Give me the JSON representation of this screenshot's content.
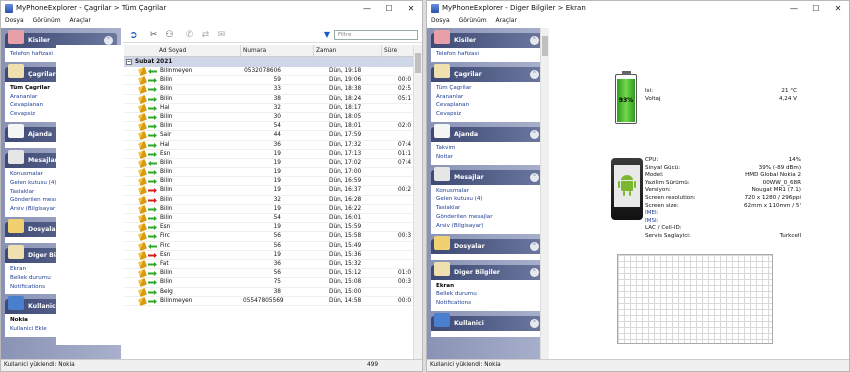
{
  "colors": {
    "sidebar_head": "#3e4a74",
    "link": "#1f3e96",
    "group_band": "#cfd6e8",
    "battery_green": "#4cc232"
  },
  "left_window": {
    "title": "MyPhoneExplorer - Çagrilar > Tüm Çagrilar",
    "controls": [
      "—",
      "☐",
      "✕"
    ],
    "menu": [
      "Dosya",
      "Görünüm",
      "Araçlar"
    ],
    "sidebar": [
      {
        "title": "Kisiler",
        "icon": "contacts-icon",
        "items": [
          {
            "label": "Telefon hafizasi",
            "selected": false
          }
        ]
      },
      {
        "title": "Çagrilar",
        "icon": "calls-icon",
        "items": [
          {
            "label": "Tüm Çagrilar",
            "selected": true
          },
          {
            "label": "Arananlar",
            "selected": false
          },
          {
            "label": "Cevaplanan",
            "selected": false
          },
          {
            "label": "Cevapsiz",
            "selected": false
          }
        ]
      },
      {
        "title": "Ajanda",
        "icon": "calendar-icon",
        "items": []
      },
      {
        "title": "Mesajlar",
        "icon": "messages-icon",
        "items": [
          {
            "label": "Konusmalar",
            "selected": false
          },
          {
            "label": "Gelen kutusu (4)",
            "selected": false
          },
          {
            "label": "Taslaklar",
            "selected": false
          },
          {
            "label": "Gönderilen mesajlar",
            "selected": false
          },
          {
            "label": "Arsiv (Bilgisayar)",
            "selected": false
          }
        ]
      },
      {
        "title": "Dosyalar",
        "icon": "folder-icon",
        "items": []
      },
      {
        "title": "Diger Bilgiler",
        "icon": "info-icon",
        "items": [
          {
            "label": "Ekran",
            "selected": false
          },
          {
            "label": "Bellek durumu",
            "selected": false
          },
          {
            "label": "Notifications",
            "selected": false
          }
        ]
      },
      {
        "title": "Kullanici",
        "icon": "user-icon",
        "items": [
          {
            "label": "Nokia",
            "selected": true
          },
          {
            "label": "Kullanici Ekle",
            "selected": false
          }
        ]
      }
    ],
    "filter_placeholder": "Filtre",
    "columns": [
      "Ad Soyad",
      "Numara",
      "Zaman",
      "Süre"
    ],
    "group": "Subat 2021",
    "rows": [
      {
        "name": "Bilinmeyen",
        "number": "0532078606",
        "time": "Dün, 19:18",
        "dur": "",
        "dir": "in"
      },
      {
        "name": "Bilin",
        "number": "59",
        "time": "Dün, 19:06",
        "dur": "00:0",
        "dir": "out"
      },
      {
        "name": "Bilin",
        "number": "33",
        "time": "Dün, 18:38",
        "dur": "02:5",
        "dir": "out"
      },
      {
        "name": "Bilin",
        "number": "38",
        "time": "Dün, 18:24",
        "dur": "05:1",
        "dir": "out"
      },
      {
        "name": "Hal",
        "number": "32",
        "time": "Dün, 18:17",
        "dur": "",
        "dir": "out"
      },
      {
        "name": "Bilin",
        "number": "30",
        "time": "Dün, 18:05",
        "dur": "",
        "dir": "out"
      },
      {
        "name": "Bilin",
        "number": "54",
        "time": "Dün, 18:01",
        "dur": "02:0",
        "dir": "out"
      },
      {
        "name": "Sair",
        "number": "44",
        "time": "Dün, 17:59",
        "dur": "",
        "dir": "out"
      },
      {
        "name": "Hal",
        "number": "36",
        "time": "Dün, 17:32",
        "dur": "07:4",
        "dir": "out"
      },
      {
        "name": "Esn",
        "number": "19",
        "time": "Dün, 17:13",
        "dur": "01:1",
        "dir": "out"
      },
      {
        "name": "Bilin",
        "number": "19",
        "time": "Dün, 17:02",
        "dur": "07:4",
        "dir": "in"
      },
      {
        "name": "Bilin",
        "number": "19",
        "time": "Dün, 17:00",
        "dur": "",
        "dir": "out"
      },
      {
        "name": "Bilin",
        "number": "19",
        "time": "Dün, 16:59",
        "dur": "",
        "dir": "out"
      },
      {
        "name": "Bilin",
        "number": "19",
        "time": "Dün, 16:37",
        "dur": "00:2",
        "dir": "missed"
      },
      {
        "name": "Bilin",
        "number": "32",
        "time": "Dün, 16:28",
        "dur": "",
        "dir": "missed"
      },
      {
        "name": "Bilin",
        "number": "19",
        "time": "Dün, 16:22",
        "dur": "",
        "dir": "out"
      },
      {
        "name": "Bilin",
        "number": "54",
        "time": "Dün, 16:01",
        "dur": "",
        "dir": "out"
      },
      {
        "name": "Esn",
        "number": "19",
        "time": "Dün, 15:59",
        "dur": "",
        "dir": "out"
      },
      {
        "name": "Firc",
        "number": "56",
        "time": "Dün, 15:58",
        "dur": "00:3",
        "dir": "out"
      },
      {
        "name": "Firc",
        "number": "56",
        "time": "Dün, 15:49",
        "dur": "",
        "dir": "in"
      },
      {
        "name": "Esn",
        "number": "19",
        "time": "Dün, 15:36",
        "dur": "",
        "dir": "missed"
      },
      {
        "name": "Fat",
        "number": "36",
        "time": "Dün, 15:32",
        "dur": "",
        "dir": "out"
      },
      {
        "name": "Bilin",
        "number": "56",
        "time": "Dün, 15:12",
        "dur": "01:0",
        "dir": "out"
      },
      {
        "name": "Bilin",
        "number": "75",
        "time": "Dün, 15:08",
        "dur": "00:3",
        "dir": "out"
      },
      {
        "name": "Belg",
        "number": "38",
        "time": "Dün, 15:00",
        "dur": "",
        "dir": "out"
      },
      {
        "name": "Bilinmeyen",
        "number": "05547805569",
        "time": "Dün, 14:58",
        "dur": "00:0",
        "dir": "out"
      }
    ],
    "status": "Kullanici yüklendi: Nokia",
    "count": "499"
  },
  "right_window": {
    "title": "MyPhoneExplorer - Diger Bilgiler > Ekran",
    "controls": [
      "—",
      "☐",
      "✕"
    ],
    "menu": [
      "Dosya",
      "Görünüm",
      "Araçlar"
    ],
    "sidebar": [
      {
        "title": "Kisiler",
        "icon": "contacts-icon",
        "items": [
          {
            "label": "Telefon hafizasi",
            "selected": false
          }
        ]
      },
      {
        "title": "Çagrilar",
        "icon": "calls-icon",
        "items": [
          {
            "label": "Tüm Çagrilar",
            "selected": false
          },
          {
            "label": "Arananlar",
            "selected": false
          },
          {
            "label": "Cevaplanan",
            "selected": false
          },
          {
            "label": "Cevapsiz",
            "selected": false
          }
        ]
      },
      {
        "title": "Ajanda",
        "icon": "calendar-icon",
        "items": [
          {
            "label": "Takvim",
            "selected": false
          },
          {
            "label": "Notlar",
            "selected": false
          }
        ]
      },
      {
        "title": "Mesajlar",
        "icon": "messages-icon",
        "items": [
          {
            "label": "Konusmalar",
            "selected": false
          },
          {
            "label": "Gelen kutusu (4)",
            "selected": false
          },
          {
            "label": "Taslaklar",
            "selected": false
          },
          {
            "label": "Gönderilen mesajlar",
            "selected": false
          },
          {
            "label": "Arsiv (Bilgisayar)",
            "selected": false
          }
        ]
      },
      {
        "title": "Dosyalar",
        "icon": "folder-icon",
        "items": []
      },
      {
        "title": "Diger Bilgiler",
        "icon": "info-icon",
        "items": [
          {
            "label": "Ekran",
            "selected": true
          },
          {
            "label": "Bellek durumu",
            "selected": false
          },
          {
            "label": "Notifications",
            "selected": false
          }
        ]
      },
      {
        "title": "Kullanici",
        "icon": "user-icon",
        "items": []
      }
    ],
    "battery": {
      "level_percent": 93,
      "label": "93%"
    },
    "battery_info": [
      {
        "key": "Isi:",
        "value": "21 °C"
      },
      {
        "key": "Voltaj",
        "value": "4,24 V"
      }
    ],
    "device_info": [
      {
        "key": "CPU:",
        "value": "14%"
      },
      {
        "key": "Sinyal Gücü:",
        "value": "39% (-89 dBm)"
      },
      {
        "key": "Model:",
        "value": "HMD Global Nokia 2"
      },
      {
        "key": "Yazilim Sürümü:",
        "value": "00WW_0_68R"
      },
      {
        "key": "Versiyon:",
        "value": "Nougat MR1 (7.1)"
      },
      {
        "key": "Screen resolution:",
        "value": "720 x 1280 / 296ppi"
      },
      {
        "key": "Screen size:",
        "value": "62mm x 110mm / 5'"
      },
      {
        "key": "IMEI:",
        "value": ""
      },
      {
        "key": "IMSI:",
        "value": ""
      },
      {
        "key": "LAC / Cell-ID:",
        "value": ""
      },
      {
        "key": "Servis Saglayici:",
        "value": "Turkcell"
      }
    ],
    "status": "Kullanici yüklendi: Nokia"
  }
}
